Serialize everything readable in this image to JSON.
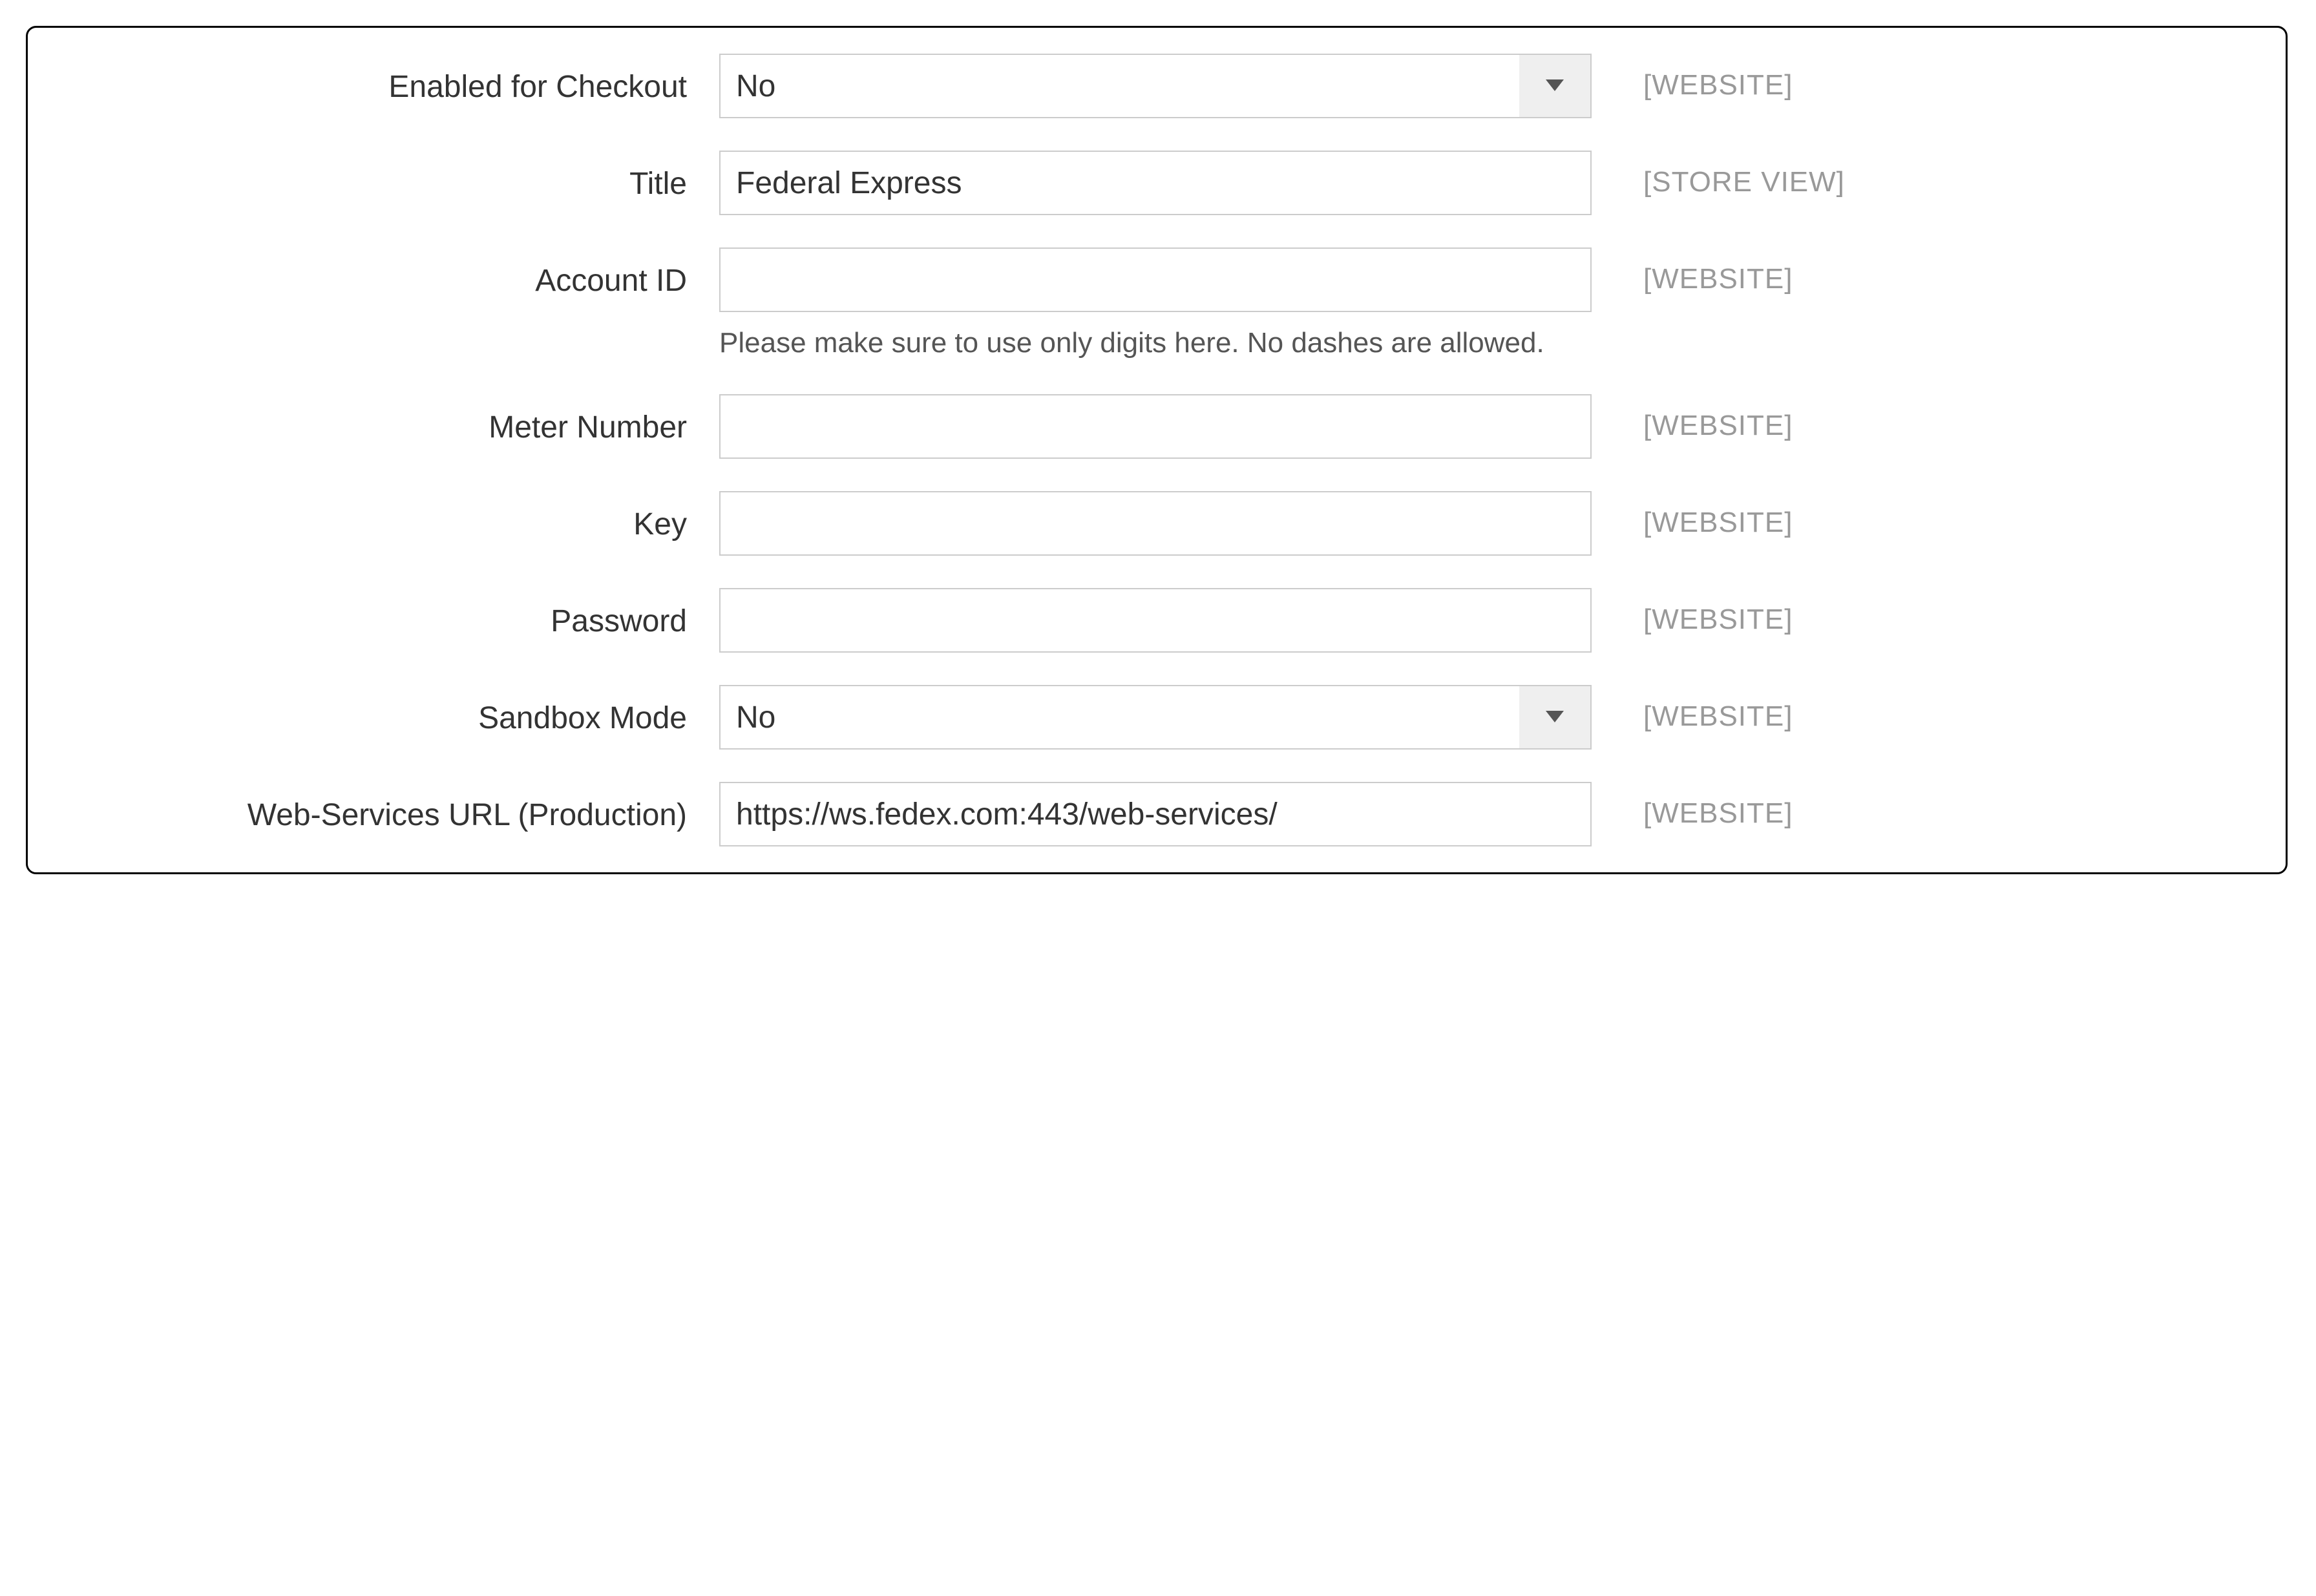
{
  "fields": {
    "enabled_for_checkout": {
      "label": "Enabled for Checkout",
      "value": "No",
      "scope": "[WEBSITE]"
    },
    "title": {
      "label": "Title",
      "value": "Federal Express",
      "scope": "[STORE VIEW]"
    },
    "account_id": {
      "label": "Account ID",
      "value": "",
      "help": "Please make sure to use only digits here. No dashes are allowed.",
      "scope": "[WEBSITE]"
    },
    "meter_number": {
      "label": "Meter Number",
      "value": "",
      "scope": "[WEBSITE]"
    },
    "key": {
      "label": "Key",
      "value": "",
      "scope": "[WEBSITE]"
    },
    "password": {
      "label": "Password",
      "value": "",
      "scope": "[WEBSITE]"
    },
    "sandbox_mode": {
      "label": "Sandbox Mode",
      "value": "No",
      "scope": "[WEBSITE]"
    },
    "web_services_url": {
      "label": "Web-Services URL (Production)",
      "value": "https://ws.fedex.com:443/web-services/",
      "scope": "[WEBSITE]"
    }
  }
}
